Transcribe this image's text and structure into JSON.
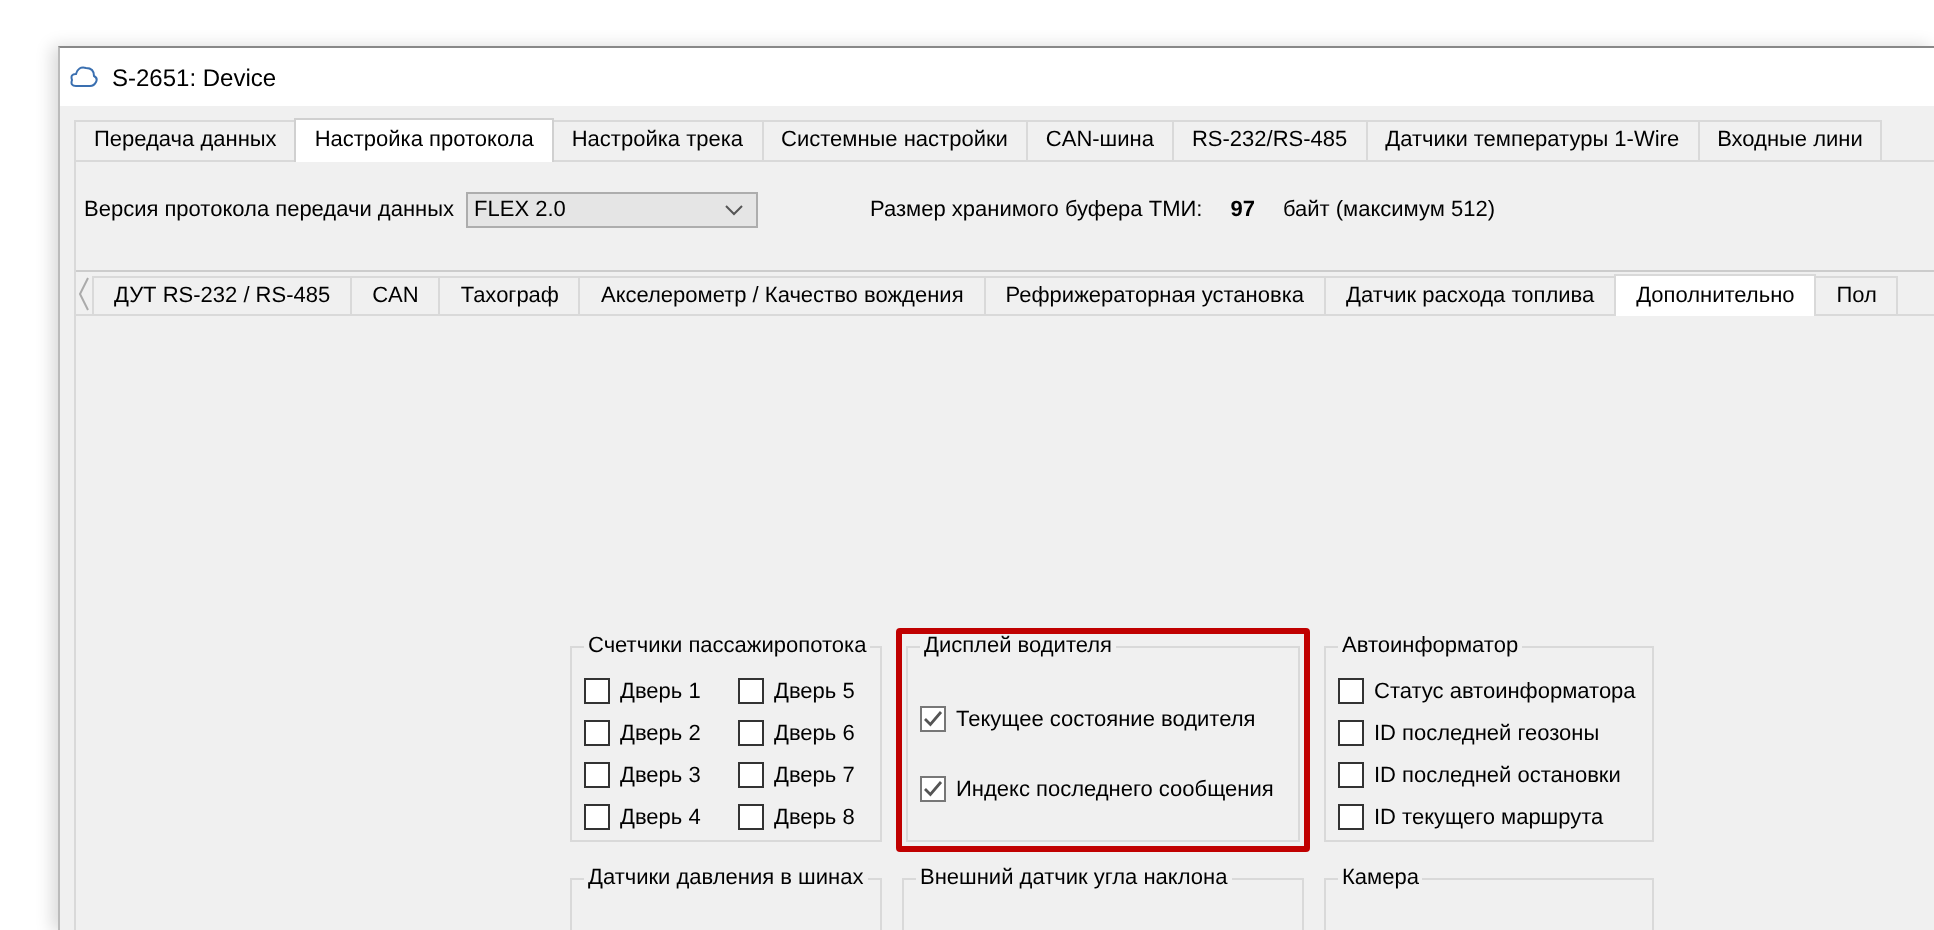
{
  "window": {
    "title": "S-2651: Device"
  },
  "tabs": [
    {
      "label": "Передача данных",
      "selected": false
    },
    {
      "label": "Настройка протокола",
      "selected": true
    },
    {
      "label": "Настройка трека",
      "selected": false
    },
    {
      "label": "Системные настройки",
      "selected": false
    },
    {
      "label": "CAN-шина",
      "selected": false
    },
    {
      "label": "RS-232/RS-485",
      "selected": false
    },
    {
      "label": "Датчики температуры 1-Wire",
      "selected": false
    },
    {
      "label": "Входные лини",
      "selected": false
    }
  ],
  "protocol": {
    "label": "Версия протокола передачи данных",
    "value": "FLEX 2.0"
  },
  "buffer": {
    "label": "Размер хранимого буфера ТМИ:",
    "value": "97",
    "unit": "байт (максимум 512)"
  },
  "subtabs": [
    {
      "label": "ДУТ RS-232 / RS-485",
      "selected": false
    },
    {
      "label": "CAN",
      "selected": false
    },
    {
      "label": "Тахограф",
      "selected": false
    },
    {
      "label": "Акселерометр / Качество вождения",
      "selected": false
    },
    {
      "label": "Рефрижераторная установка",
      "selected": false
    },
    {
      "label": "Датчик расхода топлива",
      "selected": false
    },
    {
      "label": "Дополнительно",
      "selected": true
    },
    {
      "label": "Пол",
      "selected": false
    }
  ],
  "groups": [
    {
      "title": "Счетчики пассажиропотока",
      "highlighted": false,
      "kind": "grid",
      "items": [
        {
          "label": "Дверь 1",
          "checked": false
        },
        {
          "label": "Дверь 5",
          "checked": false
        },
        {
          "label": "Дверь 2",
          "checked": false
        },
        {
          "label": "Дверь 6",
          "checked": false
        },
        {
          "label": "Дверь 3",
          "checked": false
        },
        {
          "label": "Дверь 7",
          "checked": false
        },
        {
          "label": "Дверь 4",
          "checked": false
        },
        {
          "label": "Дверь 8",
          "checked": false
        }
      ]
    },
    {
      "title": "Дисплей водителя",
      "highlighted": true,
      "kind": "list",
      "items": [
        {
          "label": "Текущее состояние водителя",
          "checked": true
        },
        {
          "label": "Индекс последнего сообщения",
          "checked": true
        }
      ]
    },
    {
      "title": "Автоинформатор",
      "highlighted": false,
      "kind": "list",
      "items": [
        {
          "label": "Статус автоинформатора",
          "checked": false
        },
        {
          "label": "ID последней геозоны",
          "checked": false
        },
        {
          "label": "ID последней остановки",
          "checked": false
        },
        {
          "label": "ID текущего маршрута",
          "checked": false
        }
      ]
    }
  ],
  "bottom_groups": [
    {
      "title": "Датчики давления в шинах"
    },
    {
      "title": "Внешний датчик угла наклона"
    },
    {
      "title": "Камера"
    }
  ]
}
